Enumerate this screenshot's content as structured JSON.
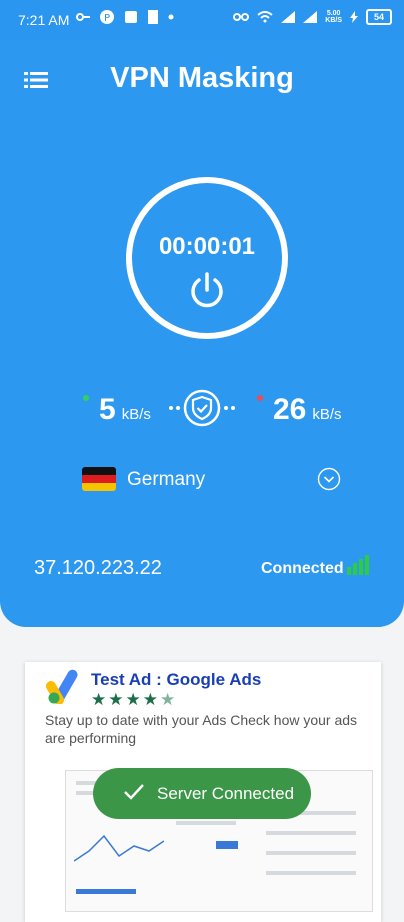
{
  "status_bar": {
    "time": "7:21 AM",
    "battery": "54",
    "net_speed_top": "5.00",
    "net_speed_bottom": "KB/S"
  },
  "header": {
    "title": "VPN Masking",
    "menu_icon": "hamburger-menu-icon"
  },
  "connection": {
    "timer": "00:00:01",
    "power_icon": "power-icon",
    "download_value": "5",
    "download_unit": "kB/s",
    "upload_value": "26",
    "upload_unit": "kB/s",
    "country": "Germany",
    "ip": "37.120.223.22",
    "status": "Connected",
    "colors": {
      "accent": "#2c98f0",
      "download_dot": "#2fd35a",
      "upload_dot": "#f14b4b",
      "signal": "#2ecc40"
    }
  },
  "ad": {
    "title": "Test Ad : Google Ads",
    "rating": 4.5,
    "description": "Stay up to date with your Ads Check how your ads are performing"
  },
  "toast": {
    "message": "Server Connected"
  }
}
